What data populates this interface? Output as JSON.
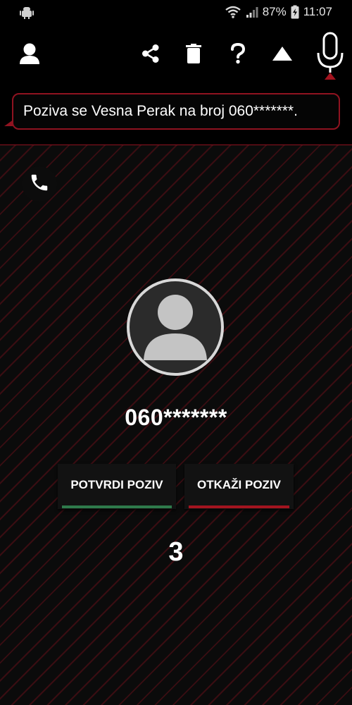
{
  "status_bar": {
    "battery": "87%",
    "time": "11:07",
    "icons": [
      "android-notification-icon",
      "wifi-icon",
      "signal-icon",
      "battery-charging-icon"
    ]
  },
  "toolbar": {
    "icons": [
      "person-icon",
      "share-icon",
      "trash-icon",
      "question-icon",
      "triangle-up-icon",
      "microphone-icon"
    ]
  },
  "message": {
    "text": "Poziva se Vesna Perak na broj 060*******."
  },
  "contact": {
    "number": "060*******"
  },
  "actions": {
    "confirm_label": "POTVRDI POZIV",
    "cancel_label": "OTKAŽI POZIV"
  },
  "countdown": "3",
  "colors": {
    "accent": "#8f1320",
    "confirm_bar": "#2f7a4b",
    "cancel_bar": "#a3141f",
    "background_stripe": "#3a0d12"
  }
}
